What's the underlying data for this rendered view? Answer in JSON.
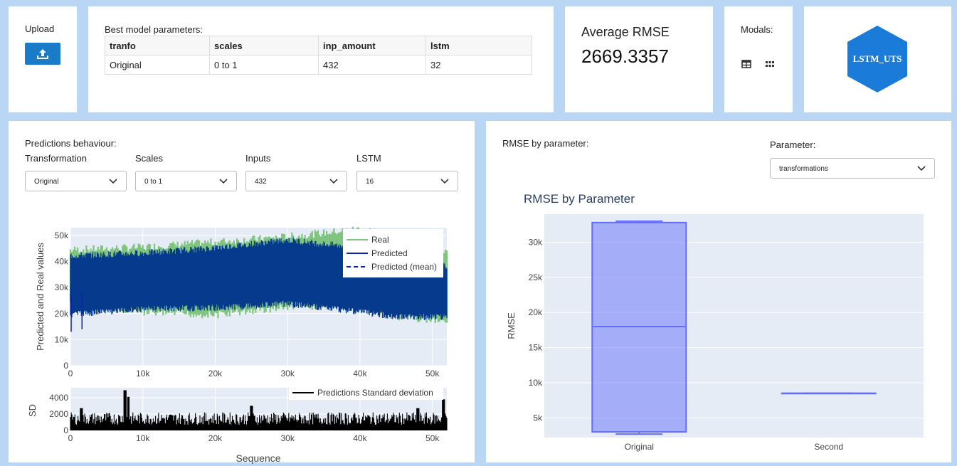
{
  "upload": {
    "label": "Upload",
    "icon": "upload-icon"
  },
  "params": {
    "title": "Best model parameters:",
    "headers": [
      "tranfo",
      "scales",
      "inp_amount",
      "lstm"
    ],
    "rows": [
      [
        "Original",
        "0 to 1",
        "432",
        "32"
      ]
    ]
  },
  "rmse": {
    "title": "Average RMSE",
    "value": "2669.3357"
  },
  "modals": {
    "label": "Modals:",
    "icons": [
      "table-icon",
      "grid-icon"
    ]
  },
  "logo": {
    "text": "LSTM_UTS",
    "color": "#1a7bd9"
  },
  "predictions": {
    "title": "Predictions behaviour:",
    "dropdowns": [
      {
        "label": "Transformation",
        "value": "Original"
      },
      {
        "label": "Scales",
        "value": "0 to 1"
      },
      {
        "label": "Inputs",
        "value": "432"
      },
      {
        "label": "LSTM",
        "value": "16"
      }
    ]
  },
  "rmse_param": {
    "title": "RMSE by parameter:",
    "param_label": "Parameter:",
    "param_value": "transformations"
  },
  "chart_data": [
    {
      "type": "line",
      "ylabel": "Predicted and Real values",
      "x_ticks": [
        "0",
        "10k",
        "20k",
        "30k",
        "40k",
        "50k"
      ],
      "y_ticks": [
        "0",
        "10k",
        "20k",
        "30k",
        "40k",
        "50k"
      ],
      "xlim": [
        0,
        52000
      ],
      "ylim": [
        0,
        53000
      ],
      "legend_position": "top-right",
      "series": [
        {
          "name": "Real",
          "color": "#7fc47f",
          "low": [
            26000,
            22000,
            21000,
            24000,
            25000,
            20000,
            19000
          ],
          "high": [
            43000,
            44000,
            46000,
            48000,
            51000,
            49000,
            42000
          ]
        },
        {
          "name": "Predicted",
          "color": "#0a1fbf"
        },
        {
          "name": "Predicted (mean)",
          "color": "#0a1fbf",
          "style": "dashed"
        }
      ],
      "band_x": [
        0,
        10000,
        20000,
        30000,
        40000,
        45000,
        52000
      ],
      "band_low": [
        21000,
        23000,
        23500,
        25000,
        22000,
        20000,
        20000
      ],
      "band_high": [
        41000,
        42000,
        44000,
        47000,
        44000,
        39000,
        37000
      ]
    },
    {
      "type": "line",
      "xlabel": "Sequence",
      "ylabel": "SD",
      "x_ticks": [
        "0",
        "10k",
        "20k",
        "30k",
        "40k",
        "50k"
      ],
      "y_ticks": [
        "0",
        "2000",
        "4000"
      ],
      "xlim": [
        0,
        52000
      ],
      "ylim": [
        0,
        5200
      ],
      "legend_position": "top-right",
      "series": [
        {
          "name": "Predictions Standard deviation",
          "color": "#000000"
        }
      ],
      "peaks_x": [
        7500,
        8000,
        1500,
        25000,
        48000,
        51500
      ],
      "peaks_y": [
        4900,
        4100,
        2700,
        3000,
        2700,
        3800
      ]
    },
    {
      "type": "box",
      "title": "RMSE by Parameter",
      "ylabel": "RMSE",
      "categories": [
        "Original",
        "Second"
      ],
      "y_ticks": [
        "5k",
        "10k",
        "15k",
        "20k",
        "25k",
        "30k"
      ],
      "ylim": [
        2200,
        34000
      ],
      "boxes": [
        {
          "name": "Original",
          "min": 2700,
          "q1": 3000,
          "median": 18000,
          "q3": 32800,
          "max": 33000
        },
        {
          "name": "Second",
          "min": 8500,
          "q1": 8500,
          "median": 8500,
          "q3": 8500,
          "max": 8500
        }
      ],
      "color": "#636efa"
    }
  ]
}
